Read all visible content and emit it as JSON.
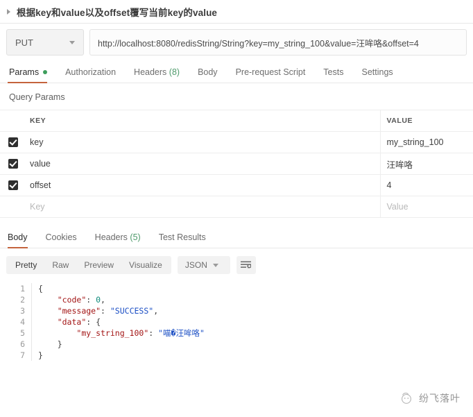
{
  "window": {
    "title": "根据key和value以及offset覆写当前key的value",
    "collapse_icon": "triangle-right-icon"
  },
  "request": {
    "method": "PUT",
    "method_dropdown_icon": "chevron-down-icon",
    "url": "http://localhost:8080/redisString/String?key=my_string_100&value=汪哞咯&offset=4",
    "tabs": [
      {
        "label": "Params",
        "active": true,
        "indicator": "dot"
      },
      {
        "label": "Authorization",
        "active": false
      },
      {
        "label": "Headers",
        "active": false,
        "count": "(8)"
      },
      {
        "label": "Body",
        "active": false
      },
      {
        "label": "Pre-request Script",
        "active": false
      },
      {
        "label": "Tests",
        "active": false
      },
      {
        "label": "Settings",
        "active": false
      }
    ],
    "accent_color": "#c4633c",
    "dot_color": "#3d9e5c"
  },
  "query_params": {
    "section_label": "Query Params",
    "columns": {
      "key": "KEY",
      "value": "VALUE"
    },
    "rows": [
      {
        "checked": true,
        "key": "key",
        "value": "my_string_100"
      },
      {
        "checked": true,
        "key": "value",
        "value": "汪哞咯"
      },
      {
        "checked": true,
        "key": "offset",
        "value": "4"
      }
    ],
    "empty_row": {
      "key_placeholder": "Key",
      "value_placeholder": "Value"
    }
  },
  "response": {
    "tabs": [
      {
        "label": "Body",
        "active": true
      },
      {
        "label": "Cookies",
        "active": false
      },
      {
        "label": "Headers",
        "active": false,
        "count": "(5)"
      },
      {
        "label": "Test Results",
        "active": false
      }
    ],
    "format_tabs": [
      {
        "label": "Pretty",
        "active": true
      },
      {
        "label": "Raw",
        "active": false
      },
      {
        "label": "Preview",
        "active": false
      },
      {
        "label": "Visualize",
        "active": false
      }
    ],
    "language": "JSON",
    "language_dropdown_icon": "chevron-down-icon",
    "wrap_button_icon": "word-wrap-icon",
    "line_numbers": [
      "1",
      "2",
      "3",
      "4",
      "5",
      "6",
      "7"
    ],
    "body_lines": [
      [
        {
          "t": "{",
          "c": "p-json"
        }
      ],
      [
        {
          "t": "    ",
          "c": "p-json"
        },
        {
          "t": "\"code\"",
          "c": "k-json"
        },
        {
          "t": ": ",
          "c": "p-json"
        },
        {
          "t": "0",
          "c": "n-json"
        },
        {
          "t": ",",
          "c": "p-json"
        }
      ],
      [
        {
          "t": "    ",
          "c": "p-json"
        },
        {
          "t": "\"message\"",
          "c": "k-json"
        },
        {
          "t": ": ",
          "c": "p-json"
        },
        {
          "t": "\"SUCCESS\"",
          "c": "s-json"
        },
        {
          "t": ",",
          "c": "p-json"
        }
      ],
      [
        {
          "t": "    ",
          "c": "p-json"
        },
        {
          "t": "\"data\"",
          "c": "k-json"
        },
        {
          "t": ": {",
          "c": "p-json"
        }
      ],
      [
        {
          "t": "        ",
          "c": "p-json"
        },
        {
          "t": "\"my_string_100\"",
          "c": "k-json"
        },
        {
          "t": ": ",
          "c": "p-json"
        },
        {
          "t": "\"喵�汪哞咯\"",
          "c": "s-json"
        }
      ],
      [
        {
          "t": "    }",
          "c": "p-json"
        }
      ],
      [
        {
          "t": "}",
          "c": "p-json"
        }
      ]
    ]
  },
  "watermark": {
    "text": "纷飞落叶",
    "icon": "logo-icon"
  }
}
